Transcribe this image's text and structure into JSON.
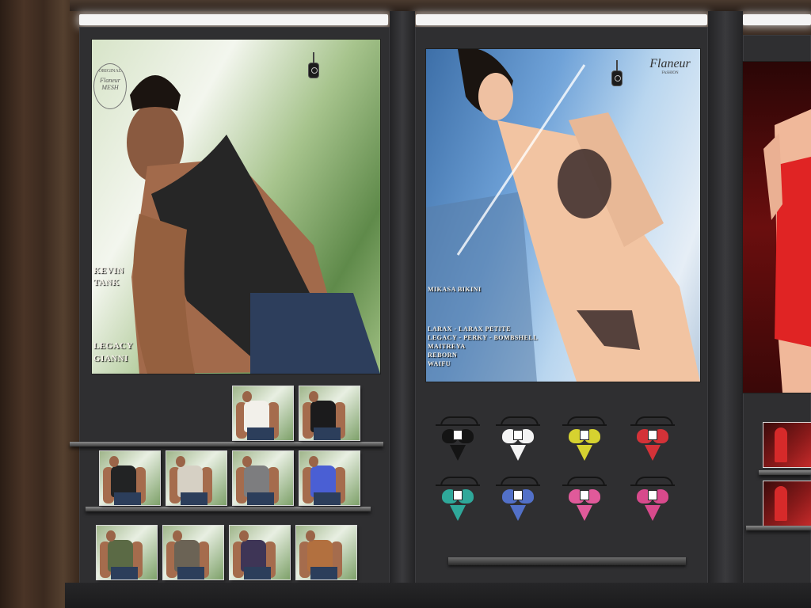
{
  "posters": {
    "kevin": {
      "brand_logo": "Flaneur MESH",
      "brand_sub": "ORIGINAL",
      "title_line1": "KEVIN",
      "title_line2": "TANK",
      "body_line1": "LEGACY",
      "body_line2": "GIANNI"
    },
    "mikasa": {
      "brand_logo": "Flaneur",
      "brand_sub": "FASHION",
      "title": "MIKASA BIKINI",
      "bodies": [
        "LARAX - LARAX PETITE",
        "LEGACY - PERKY - BOMBSHELL",
        "MAITREYA",
        "REBORN",
        "WAIFU"
      ]
    }
  },
  "tank_colors": {
    "row1": [
      "#f2f0ea",
      "#1b1b1c"
    ],
    "row2": [
      "#222324",
      "#d6d0c4",
      "#7d7d7f",
      "#4a5fd4"
    ],
    "row3": [
      "#5b6a45",
      "#6b6355",
      "#3e3556",
      "#b2703f"
    ]
  },
  "bikini_colors": {
    "row1": [
      "#141414",
      "#f4f4f4",
      "#d6d230",
      "#d43238"
    ],
    "row2": [
      "#2fa89a",
      "#5270c8",
      "#e05a9a",
      "#d84a8c"
    ]
  }
}
